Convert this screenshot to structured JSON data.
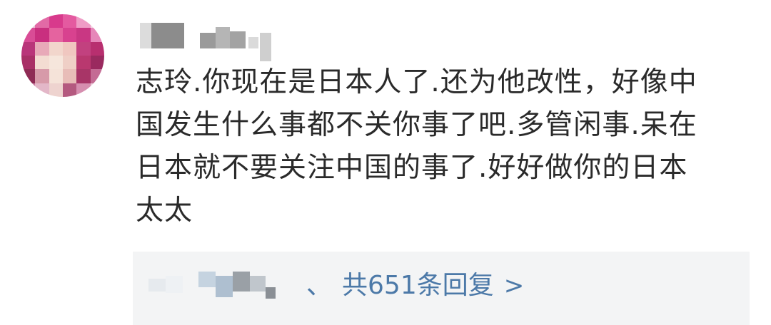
{
  "comment": {
    "avatar_icon": "pixelated-avatar",
    "username_obscured": true,
    "text": "志玲.你现在是日本人了.还为他改性，好像中\n国发生什么事都不关你事了吧.多管闲事.呆在\n日本就不要关注中国的事了.好好做你的日本\n太太"
  },
  "reply": {
    "replier_separator": "、",
    "count_label": "共651条回复",
    "chevron": ">",
    "link_color": "#4c79a8"
  },
  "colors": {
    "background": "#ffffff",
    "text": "#2a2a2a",
    "reply_bg": "#f3f4f5"
  }
}
